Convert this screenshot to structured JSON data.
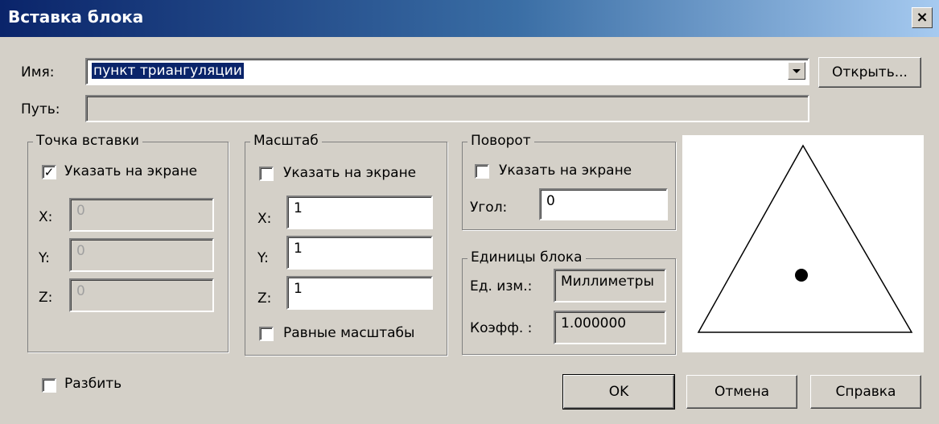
{
  "window": {
    "title": "Вставка блока",
    "close_glyph": "×"
  },
  "name_row": {
    "label": "Имя:",
    "value": "пункт триангуляции",
    "open_button": "Открыть..."
  },
  "path_row": {
    "label": "Путь:",
    "value": ""
  },
  "insertion_point": {
    "legend": "Точка вставки",
    "specify_on_screen": {
      "label": "Указать на экране",
      "checked": true,
      "mark": "✓"
    },
    "x": {
      "label": "X:",
      "value": "0"
    },
    "y": {
      "label": "Y:",
      "value": "0"
    },
    "z": {
      "label": "Z:",
      "value": "0"
    }
  },
  "scale": {
    "legend": "Масштаб",
    "specify_on_screen": {
      "label": "Указать на экране",
      "checked": false
    },
    "x": {
      "label": "X:",
      "value": "1"
    },
    "y": {
      "label": "Y:",
      "value": "1"
    },
    "z": {
      "label": "Z:",
      "value": "1"
    },
    "uniform": {
      "label": "Равные масштабы",
      "checked": false
    }
  },
  "rotation": {
    "legend": "Поворот",
    "specify_on_screen": {
      "label": "Указать на экране",
      "checked": false
    },
    "angle": {
      "label": "Угол:",
      "value": "0"
    }
  },
  "block_units": {
    "legend": "Единицы блока",
    "unit": {
      "label": "Ед. изм.:",
      "value": "Миллиметры"
    },
    "factor": {
      "label": "Коэфф. :",
      "value": "1.000000"
    }
  },
  "explode": {
    "label": "Разбить",
    "checked": false
  },
  "buttons": {
    "ok": "OK",
    "cancel": "Отмена",
    "help": "Справка"
  },
  "preview": {
    "icon": "triangulation-point-triangle-icon"
  }
}
